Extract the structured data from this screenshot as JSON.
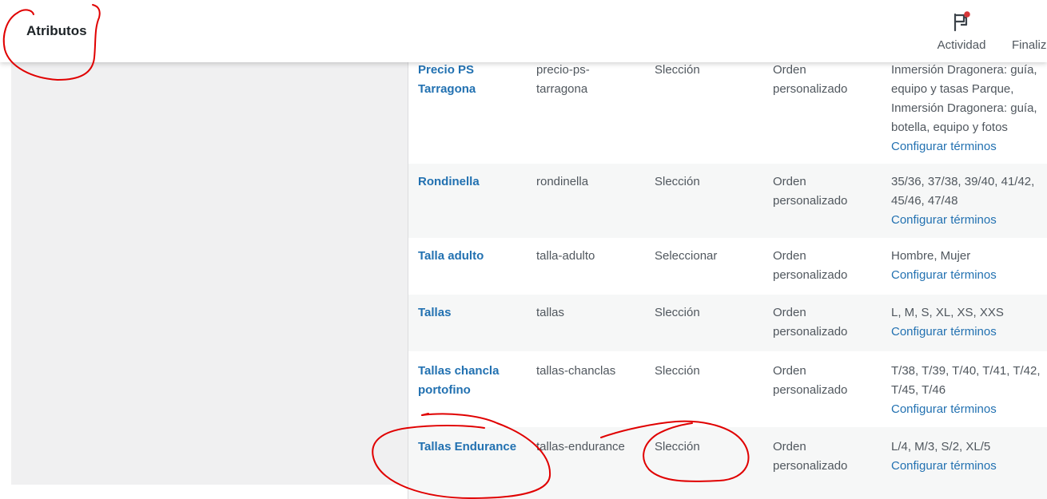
{
  "header": {
    "title": "Atributos",
    "activity_icon": "flag-icon",
    "activity_label": "Actividad",
    "finish_label": "Finaliz"
  },
  "table": {
    "rows": [
      {
        "name": "Precio PS Tarragona",
        "slug": "precio-ps-tarragona",
        "type": "Slección",
        "order": "Orden personalizado",
        "terms": "Inmersión Dragonera: guía, equipo y tasas Parque, Inmersión Dragonera: guía, botella, equipo y fotos",
        "configure": "Configurar términos"
      },
      {
        "name": "Rondinella",
        "slug": "rondinella",
        "type": "Slección",
        "order": "Orden personalizado",
        "terms": "35/36, 37/38, 39/40, 41/42, 45/46, 47/48",
        "configure": "Configurar términos"
      },
      {
        "name": "Talla adulto",
        "slug": "talla-adulto",
        "type": "Seleccionar",
        "order": "Orden personalizado",
        "terms": "Hombre, Mujer",
        "configure": "Configurar términos"
      },
      {
        "name": "Tallas",
        "slug": "tallas",
        "type": "Slección",
        "order": "Orden personalizado",
        "terms": "L, M, S, XL, XS, XXS",
        "configure": "Configurar términos"
      },
      {
        "name": "Tallas chancla portofino",
        "slug": "tallas-chanclas",
        "type": "Slección",
        "order": "Orden personalizado",
        "terms": "T/38, T/39, T/40, T/41, T/42, T/45, T/46",
        "configure": "Configurar términos"
      },
      {
        "name": "Tallas Endurance",
        "slug": "tallas-endurance",
        "type": "Slección",
        "order": "Orden personalizado",
        "terms": "L/4, M/3, S/2, XL/5",
        "configure": "Configurar términos"
      }
    ]
  },
  "colors": {
    "link": "#2271b1",
    "text": "#50575e",
    "annotation": "#e00000"
  }
}
